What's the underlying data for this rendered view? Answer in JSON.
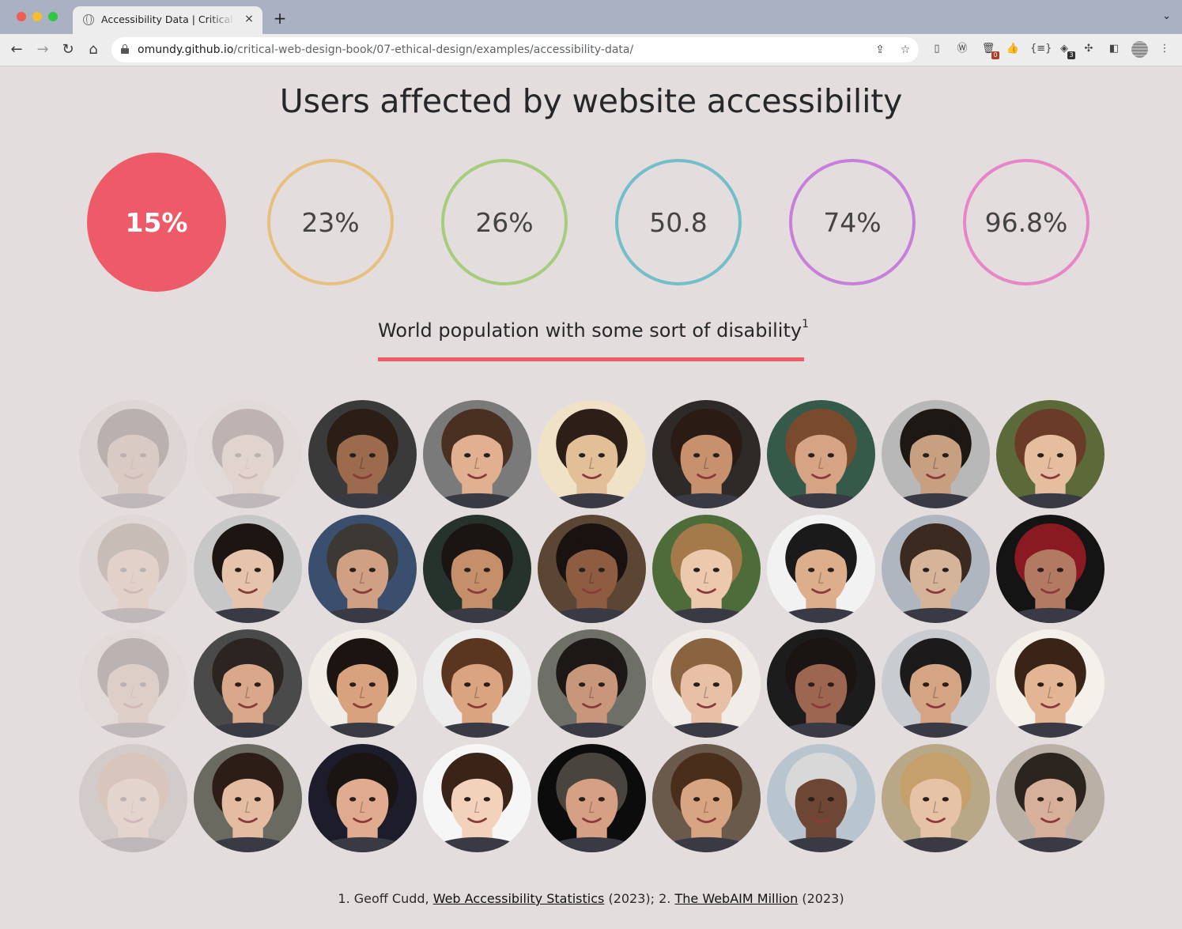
{
  "browser": {
    "tab_title": "Accessibility Data | Critical Web Design",
    "tab_close": "×",
    "new_tab": "+",
    "tab_menu": "⌄",
    "url_host": "omundy.github.io",
    "url_path": "/critical-web-design-book/07-ethical-design/examples/accessibility-data/",
    "nav": {
      "back": "←",
      "forward": "→",
      "reload": "↻",
      "home": "⌂"
    },
    "extensions": [
      {
        "name": "page-icon",
        "glyph": "▯",
        "badge": ""
      },
      {
        "name": "wordpress-icon",
        "glyph": "Ⓦ",
        "badge": ""
      },
      {
        "name": "trash-icon",
        "glyph": "🗑",
        "badge": "0"
      },
      {
        "name": "thumbs-up-icon",
        "glyph": "👍",
        "badge": ""
      },
      {
        "name": "json-icon",
        "glyph": "{≡}",
        "badge": ""
      },
      {
        "name": "robot-icon",
        "glyph": "◈",
        "badge": "3"
      },
      {
        "name": "puzzle-icon",
        "glyph": "✣",
        "badge": ""
      },
      {
        "name": "sidebar-icon",
        "glyph": "◧",
        "badge": ""
      },
      {
        "name": "menu-icon",
        "glyph": "⋮",
        "badge": ""
      }
    ]
  },
  "page": {
    "title": "Users affected by website accessibility",
    "stats": [
      {
        "label": "15%",
        "color": "#ec5b67",
        "active": true
      },
      {
        "label": "23%",
        "color": "#e6c07f",
        "active": false
      },
      {
        "label": "26%",
        "color": "#a6cc7c",
        "active": false
      },
      {
        "label": "50.8",
        "color": "#72bec9",
        "active": false
      },
      {
        "label": "74%",
        "color": "#c67fdb",
        "active": false
      },
      {
        "label": "96.8%",
        "color": "#e786c6",
        "active": false
      }
    ],
    "caption": "World population with some sort of disability",
    "caption_note": "1",
    "faces_total": 36,
    "faces_highlighted_count": 5,
    "footer": {
      "prefix": "1. Geoff Cudd, ",
      "link1": "Web Accessibility Statistics",
      "middle": " (2023); 2. ",
      "link2": "The WebAIM Million",
      "suffix": " (2023)"
    }
  },
  "faces": [
    {
      "skin": "#b88a6e",
      "hair": "#2a1a12",
      "bg": "#c9c2bc"
    },
    {
      "skin": "#d9b49a",
      "hair": "#3a2418",
      "bg": "#d7d2cc"
    },
    {
      "skin": "#9c6a4c",
      "hair": "#2b1e16",
      "bg": "#3a3a3a"
    },
    {
      "skin": "#e0b090",
      "hair": "#4a3020",
      "bg": "#7a7a7a"
    },
    {
      "skin": "#e3bf98",
      "hair": "#2c1f17",
      "bg": "#efe2c6"
    },
    {
      "skin": "#c7916e",
      "hair": "#2a1c14",
      "bg": "#2e2a28"
    },
    {
      "skin": "#d6a385",
      "hair": "#7a4a2e",
      "bg": "#355a4a"
    },
    {
      "skin": "#c7a082",
      "hair": "#1e1814",
      "bg": "#b8b8b8"
    },
    {
      "skin": "#e5bea0",
      "hair": "#6a3c28",
      "bg": "#5c6a3a"
    },
    {
      "skin": "#d8a986",
      "hair": "#6a4a32",
      "bg": "#cfc7bf"
    },
    {
      "skin": "#e6c4ab",
      "hair": "#1c1512",
      "bg": "#c7c7c7"
    },
    {
      "skin": "#cfa083",
      "hair": "#3c3833",
      "bg": "#3a4e6e"
    },
    {
      "skin": "#c58f6a",
      "hair": "#1a1412",
      "bg": "#26332c"
    },
    {
      "skin": "#8e5c40",
      "hair": "#1a1210",
      "bg": "#5a4632"
    },
    {
      "skin": "#ecc9ad",
      "hair": "#a57a4a",
      "bg": "#4e6c3a"
    },
    {
      "skin": "#dcae8c",
      "hair": "#1a1a1a",
      "bg": "#f2f2f2"
    },
    {
      "skin": "#d6b49a",
      "hair": "#3b2a20",
      "bg": "#b0b6c0"
    },
    {
      "skin": "#b27a62",
      "hair": "#8a1a22",
      "bg": "#141414"
    },
    {
      "skin": "#c99a7c",
      "hair": "#2c1f18",
      "bg": "#d8d2cc"
    },
    {
      "skin": "#d9a88a",
      "hair": "#2b2420",
      "bg": "#4a4a4a"
    },
    {
      "skin": "#d9a27e",
      "hair": "#1c1410",
      "bg": "#f0ede6"
    },
    {
      "skin": "#d9a47f",
      "hair": "#5a3620",
      "bg": "#ededed"
    },
    {
      "skin": "#c8967a",
      "hair": "#1c1816",
      "bg": "#6e7068"
    },
    {
      "skin": "#e7c0a6",
      "hair": "#8a6440",
      "bg": "#f0ece8"
    },
    {
      "skin": "#9c6650",
      "hair": "#1a1412",
      "bg": "#1c1c1c"
    },
    {
      "skin": "#d4a484",
      "hair": "#1c1a1a",
      "bg": "#c8ccd0"
    },
    {
      "skin": "#e3b594",
      "hair": "#3a2418",
      "bg": "#f4f0ea"
    },
    {
      "skin": "#e2b59a",
      "hair": "#b07a4a",
      "bg": "#9a9086"
    },
    {
      "skin": "#e4bca2",
      "hair": "#2c1e16",
      "bg": "#6a6a60"
    },
    {
      "skin": "#e0ab8e",
      "hair": "#1a1412",
      "bg": "#1c1c2a"
    },
    {
      "skin": "#f2d2ba",
      "hair": "#3a2418",
      "bg": "#f6f6f6"
    },
    {
      "skin": "#d6a084",
      "hair": "#4a443e",
      "bg": "#0c0c0c"
    },
    {
      "skin": "#d8a582",
      "hair": "#4a2e1c",
      "bg": "#6a5a4c"
    },
    {
      "skin": "#6e4636",
      "hair": "#d8d8d8",
      "bg": "#b8c4ce"
    },
    {
      "skin": "#e6c2a6",
      "hair": "#c6a06a",
      "bg": "#b8a888"
    },
    {
      "skin": "#d6b09a",
      "hair": "#2c241e",
      "bg": "#bab0a6"
    }
  ]
}
